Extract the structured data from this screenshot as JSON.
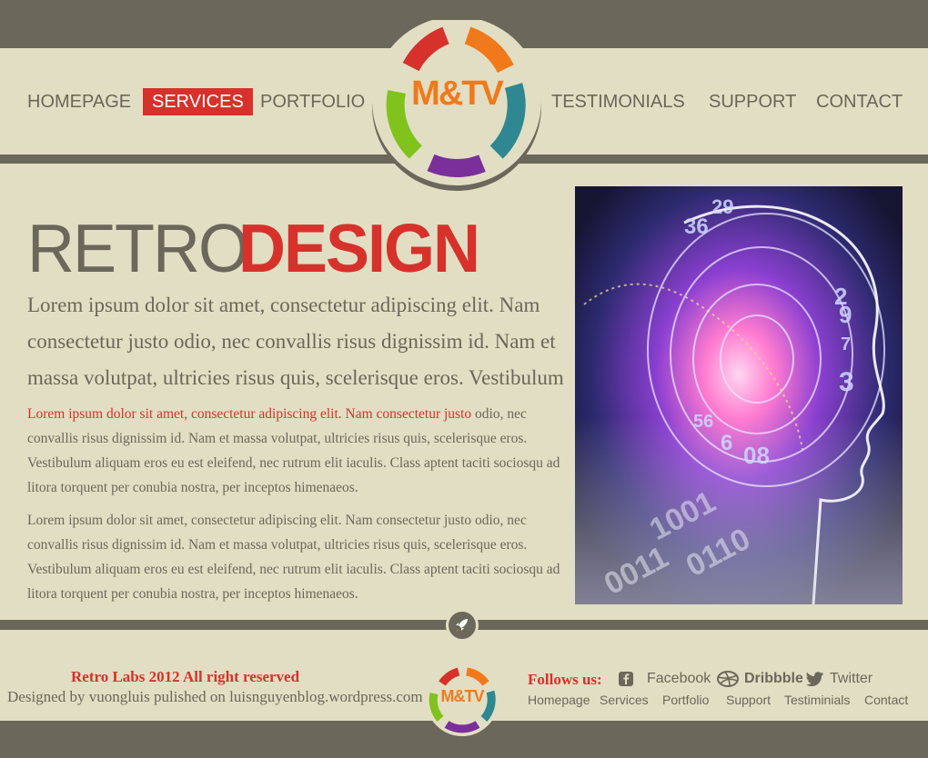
{
  "nav": {
    "homepage": "HOMEPAGE",
    "services": "SERVICES",
    "portfolio": "PORTFOLIO",
    "testimonials": "TESTIMONIALS",
    "support": "SUPPORT",
    "contact": "CONTACT"
  },
  "logo": {
    "text": "M&TV"
  },
  "hero": {
    "title_left": "RETRO",
    "title_right": "DESIGN",
    "lead": "Lorem ipsum dolor sit amet, consectetur adipiscing elit. Nam consectetur justo odio, nec convallis risus dignissim id. Nam et  massa volutpat, ultricies risus quis, scelerisque eros. Vestibulum",
    "para1_red": "Lorem ipsum dolor sit amet, consectetur adipiscing elit. Nam consectetur justo",
    "para1_rest": " odio, nec convallis risus dignissim id. Nam et massa volutpat, ultricies risus quis, scelerisque eros. Vestibulum aliquam eros eu est eleifend, nec rutrum elit iaculis. Class aptent taciti sociosqu ad litora torquent per conubia nostra, per inceptos himenaeos.",
    "para2": "Lorem ipsum dolor sit amet, consectetur adipiscing elit. Nam consectetur justo odio, nec convallis risus dignissim id. Nam et massa volutpat, ultricies risus quis, scelerisque eros. Vestibulum aliquam eros eu est eleifend, nec rutrum elit iaculis. Class aptent taciti sociosqu ad litora torquent per conubia nostra, per inceptos himenaeos."
  },
  "image": {
    "numbers": [
      "29",
      "36",
      "2",
      "9",
      "7",
      "3",
      "56",
      "6",
      "08",
      "1001",
      "0110",
      "0011"
    ]
  },
  "footer": {
    "copyright": "Retro Labs 2012 All right reserved",
    "credit": "Designed by vuongluis pulished on luisnguyenblog.wordpress.com",
    "logo_text": "M&TV",
    "follow_label": "Follows us:",
    "social": {
      "facebook": "Facebook",
      "dribbble": "Dribbble",
      "twitter": "Twitter"
    },
    "links": {
      "homepage": "Homepage",
      "services": "Services",
      "portfolio": "Portfolio",
      "support": "Support",
      "testimonials": "Testiminials",
      "contact": "Contact"
    }
  },
  "colors": {
    "background": "#6b675a",
    "panel": "#e2dec3",
    "accent": "#d6322b",
    "logo_orange": "#f07a1b",
    "ring": [
      "#d6322b",
      "#f07a1b",
      "#2f8792",
      "#7a2f9a",
      "#7fc31c"
    ]
  },
  "icons": [
    "rocket-icon",
    "facebook-icon",
    "dribbble-icon",
    "twitter-icon"
  ]
}
